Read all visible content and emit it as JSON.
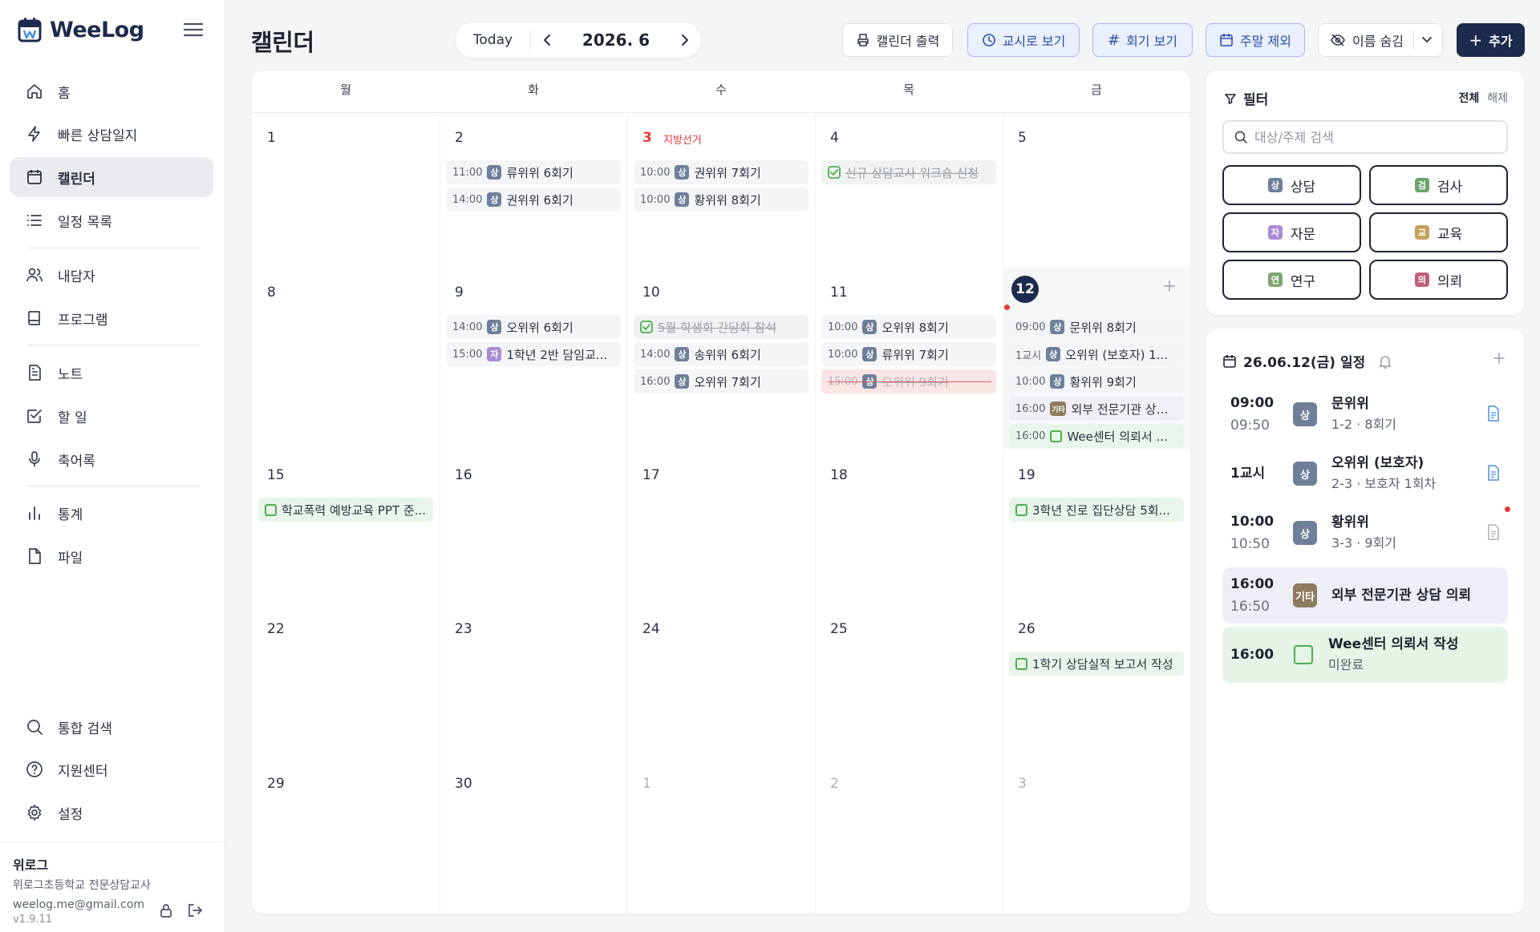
{
  "app": {
    "name": "WeeLog",
    "brand_color": "#1c2a4d"
  },
  "sidebar": {
    "items": [
      {
        "label": "홈",
        "icon": "home-icon"
      },
      {
        "label": "빠른 상담일지",
        "icon": "bolt-icon"
      },
      {
        "label": "캘린더",
        "icon": "calendar-icon",
        "active": true
      },
      {
        "label": "일정 목록",
        "icon": "list-icon"
      },
      {
        "label": "내담자",
        "icon": "users-icon"
      },
      {
        "label": "프로그램",
        "icon": "book-icon"
      },
      {
        "label": "노트",
        "icon": "note-icon"
      },
      {
        "label": "할 일",
        "icon": "checkbox-icon"
      },
      {
        "label": "축어록",
        "icon": "mic-icon"
      },
      {
        "label": "통계",
        "icon": "bar-chart-icon"
      },
      {
        "label": "파일",
        "icon": "file-icon"
      }
    ],
    "bottom_items": [
      {
        "label": "통합 검색",
        "icon": "search-icon"
      },
      {
        "label": "지원센터",
        "icon": "help-icon"
      },
      {
        "label": "설정",
        "icon": "gear-icon"
      }
    ],
    "user": {
      "name": "위로그",
      "school": "위로그초등학교 전문상담교사",
      "email": "weelog.me@gmail.com",
      "version": "v1.9.11"
    }
  },
  "header": {
    "title": "캘린더",
    "today_label": "Today",
    "month": "2026. 6",
    "buttons": {
      "print": "캘린더 출력",
      "period": "교시로 보기",
      "session": "회기 보기",
      "weekend": "주말 제외",
      "hide_name": "이름 숨김",
      "add": "추가"
    }
  },
  "calendar": {
    "weekdays": [
      "월",
      "화",
      "수",
      "목",
      "금"
    ],
    "weeks": [
      [
        {
          "day": "1",
          "events": []
        },
        {
          "day": "2",
          "events": [
            {
              "time": "11:00",
              "tag": "상",
              "name": "류위위 6회기"
            },
            {
              "time": "14:00",
              "tag": "상",
              "name": "권위위 6회기"
            }
          ]
        },
        {
          "day": "3",
          "holiday": "지방선거",
          "events": [
            {
              "time": "10:00",
              "tag": "상",
              "name": "권위위 7회기"
            },
            {
              "time": "10:00",
              "tag": "상",
              "name": "황위위 8회기"
            }
          ]
        },
        {
          "day": "4",
          "events": [
            {
              "type": "done",
              "name": "신규 상담교사 워크숍 신청"
            }
          ]
        },
        {
          "day": "5",
          "events": []
        }
      ],
      [
        {
          "day": "8",
          "events": []
        },
        {
          "day": "9",
          "events": [
            {
              "time": "14:00",
              "tag": "상",
              "name": "오위위 6회기"
            },
            {
              "time": "15:00",
              "tag": "자",
              "name": "1학년 2반 담임교..."
            }
          ]
        },
        {
          "day": "10",
          "events": [
            {
              "type": "done",
              "name": "5월 학생회 간담회 참석"
            },
            {
              "time": "14:00",
              "tag": "상",
              "name": "송위위 6회기"
            },
            {
              "time": "16:00",
              "tag": "상",
              "name": "오위위 7회기"
            }
          ]
        },
        {
          "day": "11",
          "events": [
            {
              "time": "10:00",
              "tag": "상",
              "name": "오위위 8회기"
            },
            {
              "time": "10:00",
              "tag": "상",
              "name": "류위위 7회기"
            },
            {
              "type": "cancel",
              "time": "15:00",
              "tag": "상",
              "name": "오위위 9회기"
            }
          ]
        },
        {
          "day": "12",
          "today": true,
          "events": [
            {
              "time": "09:00",
              "tag": "상",
              "name": "문위위 8회기"
            },
            {
              "time": "1교시",
              "tag": "상",
              "name": "오위위 (보호자) 1..."
            },
            {
              "time": "10:00",
              "tag": "상",
              "name": "황위위 9회기"
            },
            {
              "type": "etc",
              "time": "16:00",
              "tag": "기타",
              "name": "외부 전문기관 상담..."
            },
            {
              "type": "todo",
              "time": "16:00",
              "name": "Wee센터 의뢰서 ..."
            }
          ]
        }
      ],
      [
        {
          "day": "15",
          "events": [
            {
              "type": "todo",
              "name": "학교폭력 예방교육 PPT 준..."
            }
          ]
        },
        {
          "day": "16",
          "events": []
        },
        {
          "day": "17",
          "events": []
        },
        {
          "day": "18",
          "events": []
        },
        {
          "day": "19",
          "events": [
            {
              "type": "todo",
              "name": "3학년 진로 집단상담 5회..."
            }
          ]
        }
      ],
      [
        {
          "day": "22",
          "events": []
        },
        {
          "day": "23",
          "events": []
        },
        {
          "day": "24",
          "events": []
        },
        {
          "day": "25",
          "events": []
        },
        {
          "day": "26",
          "events": [
            {
              "type": "todo",
              "name": "1학기 상담실적 보고서 작성"
            }
          ]
        }
      ],
      [
        {
          "day": "29",
          "events": []
        },
        {
          "day": "30",
          "events": []
        },
        {
          "day": "1",
          "other": true,
          "events": []
        },
        {
          "day": "2",
          "other": true,
          "events": []
        },
        {
          "day": "3",
          "other": true,
          "events": []
        }
      ]
    ]
  },
  "tag_colors": {
    "상": "#6e7f9a",
    "자": "#a98cd6",
    "기타": "#8e7a5c",
    "검": "#6aa36c",
    "교": "#c6a15a",
    "연": "#7fa66f",
    "의": "#c0607a"
  },
  "filter": {
    "title": "필터",
    "all_label": "전체",
    "clear_label": "해제",
    "search_placeholder": "대상/주제 검색",
    "buttons": [
      {
        "tag": "상",
        "label": "상담",
        "color": "#6e7f9a"
      },
      {
        "tag": "검",
        "label": "검사",
        "color": "#6aa36c"
      },
      {
        "tag": "자",
        "label": "자문",
        "color": "#a98cd6"
      },
      {
        "tag": "교",
        "label": "교육",
        "color": "#c6a15a"
      },
      {
        "tag": "연",
        "label": "연구",
        "color": "#7fa66f"
      },
      {
        "tag": "의",
        "label": "의뢰",
        "color": "#c0607a"
      }
    ]
  },
  "day_panel": {
    "title": "26.06.12(금) 일정",
    "items": [
      {
        "start": "09:00",
        "end": "09:50",
        "tag": "상",
        "name": "문위위",
        "detail": "1-2 · 8회기",
        "doc": "blue"
      },
      {
        "start": "1교시",
        "end": "",
        "tag": "상",
        "name": "오위위 (보호자)",
        "detail": "2-3 · 보호자 1회차",
        "doc": "blue"
      },
      {
        "start": "10:00",
        "end": "10:50",
        "tag": "상",
        "name": "황위위",
        "detail": "3-3 · 9회기",
        "doc": "gray"
      },
      {
        "start": "16:00",
        "end": "16:50",
        "tag": "기타",
        "name": "외부 전문기관 상담 의뢰",
        "detail": "",
        "type": "etc"
      },
      {
        "start": "16:00",
        "end": "",
        "tag": "",
        "name": "Wee센터 의뢰서 작성",
        "detail": "미완료",
        "type": "todo"
      }
    ]
  }
}
